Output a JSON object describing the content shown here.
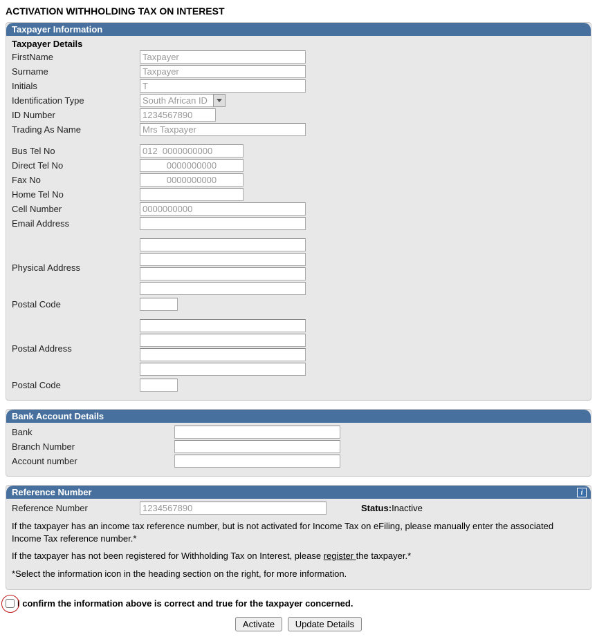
{
  "page_title": "ACTIVATION WITHHOLDING TAX ON INTEREST",
  "taxpayer": {
    "section_title": "Taxpayer Information",
    "details_title": "Taxpayer Details",
    "firstname_label": "FirstName",
    "firstname": "Taxpayer",
    "surname_label": "Surname",
    "surname": "Taxpayer",
    "initials_label": "Initials",
    "initials": "T",
    "id_type_label": "Identification Type",
    "id_type": "South African ID",
    "id_number_label": "ID Number",
    "id_number": "1234567890",
    "trading_label": "Trading As Name",
    "trading": "Mrs Taxpayer",
    "bus_tel_label": "Bus Tel No",
    "bus_tel": "012  0000000000",
    "direct_tel_label": "Direct Tel No",
    "direct_tel": "0000000000",
    "fax_label": "Fax No",
    "fax": "0000000000",
    "home_tel_label": "Home Tel No",
    "home_tel": "",
    "cell_label": "Cell Number",
    "cell": "0000000000",
    "email_label": "Email Address",
    "email": "",
    "phys_addr_label": "Physical Address",
    "phys_addr": [
      "",
      "",
      "",
      ""
    ],
    "phys_postal_label": "Postal Code",
    "phys_postal": "",
    "post_addr_label": "Postal Address",
    "post_addr": [
      "",
      "",
      "",
      ""
    ],
    "post_postal_label": "Postal Code",
    "post_postal": ""
  },
  "bank": {
    "section_title": "Bank Account Details",
    "bank_label": "Bank",
    "bank": "",
    "branch_label": "Branch Number",
    "branch": "",
    "account_label": "Account number",
    "account": ""
  },
  "ref": {
    "section_title": "Reference Number",
    "ref_label": "Reference Number",
    "ref": "1234567890",
    "status_label": "Status:",
    "status_value": "Inactive",
    "note1": "If the taxpayer has an income tax reference number, but is not activated for Income Tax on eFiling, please manually enter the associated Income Tax reference number.*",
    "note2a": "If the taxpayer has not been registered for Withholding Tax on Interest, please ",
    "note2_link": "register ",
    "note2b": "the taxpayer.*",
    "note3": "*Select the information icon in the heading section on the right, for more information."
  },
  "confirm_label": "I confirm the information above is correct and true for the taxpayer concerned.",
  "buttons": {
    "activate": "Activate",
    "update": "Update Details"
  }
}
